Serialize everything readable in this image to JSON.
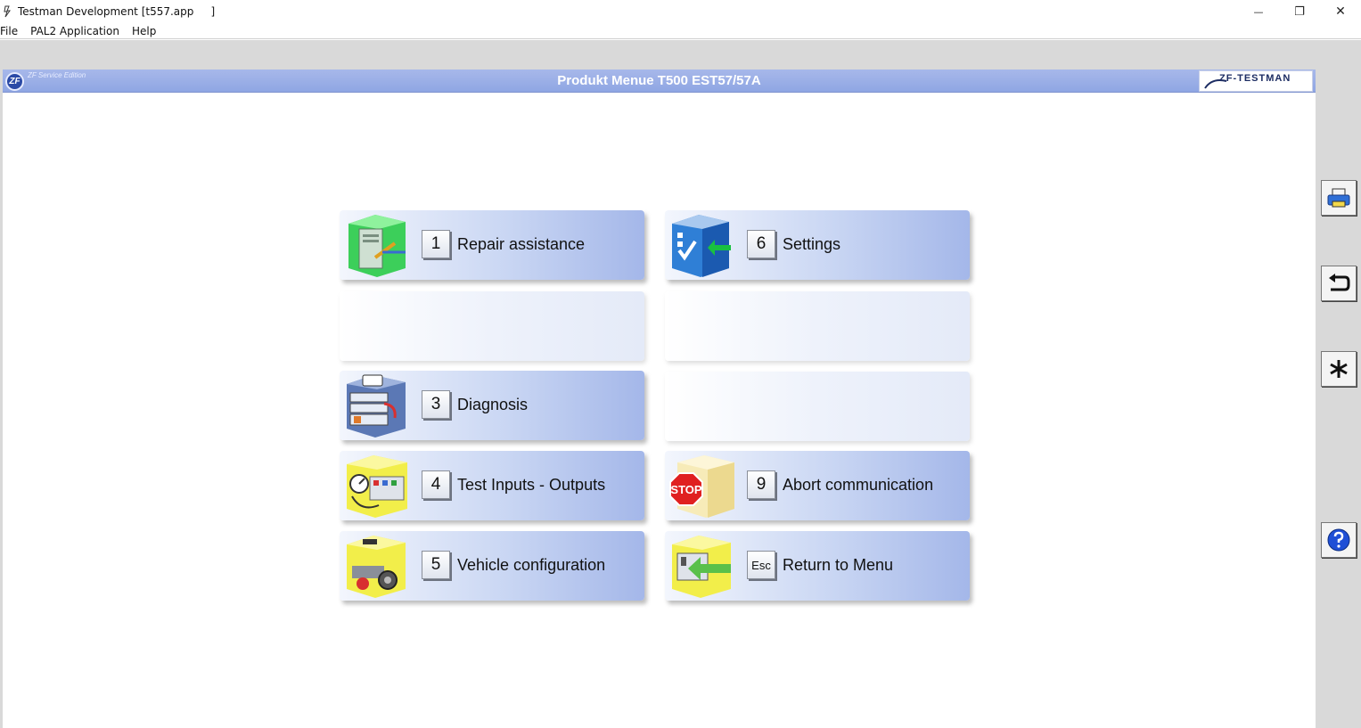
{
  "window": {
    "title": "Testman Development [t557.app     ]",
    "minimize_glyph": "—",
    "restore_glyph": "❐",
    "close_glyph": "✕"
  },
  "menu": [
    "File",
    "PAL2 Application",
    "Help"
  ],
  "header": {
    "logo_text": "ZF",
    "edition": "ZF Service Edition",
    "title": "Produkt Menue T500 EST57/57A",
    "brand": "ZF-TESTMAN"
  },
  "tiles": [
    {
      "key": "1",
      "label": "Repair assistance",
      "icon": "repair-assistance-icon"
    },
    {
      "key": "6",
      "label": "Settings",
      "icon": "settings-icon"
    },
    {
      "key": "3",
      "label": "Diagnosis",
      "icon": "diagnosis-icon"
    },
    {
      "key": "4",
      "label": "Test Inputs - Outputs",
      "icon": "test-io-icon"
    },
    {
      "key": "9",
      "label": "Abort communication",
      "icon": "stop-icon"
    },
    {
      "key": "5",
      "label": "Vehicle configuration",
      "icon": "vehicle-config-icon"
    },
    {
      "key": "Esc",
      "label": "Return to Menu",
      "icon": "return-icon"
    }
  ],
  "stop_sign_text": "STOP",
  "side_buttons": [
    "print-icon",
    "undo-icon",
    "asterisk-icon",
    "help-icon"
  ],
  "colors": {
    "header": "#97abe5",
    "tile_end": "#a4b7e9",
    "stop_red": "#e02020",
    "help_blue": "#1f4fd6"
  }
}
